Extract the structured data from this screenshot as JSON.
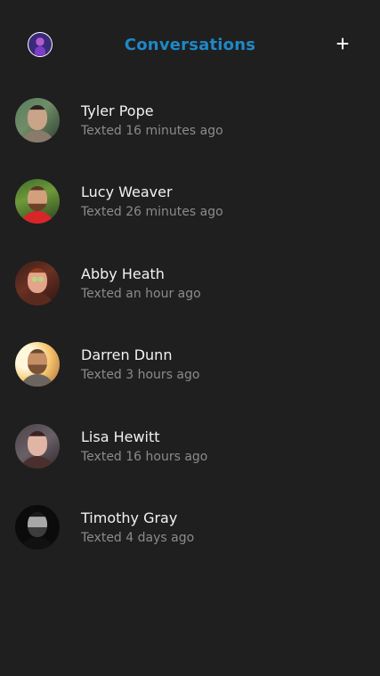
{
  "header": {
    "title": "Conversations",
    "profile_icon": "profile-avatar",
    "add_icon": "plus-icon",
    "accent_color": "#1e88c8"
  },
  "conversations": [
    {
      "name": "Tyler Pope",
      "status": "Texted 16 minutes ago"
    },
    {
      "name": "Lucy Weaver",
      "status": "Texted 26 minutes ago"
    },
    {
      "name": "Abby Heath",
      "status": "Texted an hour ago"
    },
    {
      "name": "Darren Dunn",
      "status": "Texted 3 hours ago"
    },
    {
      "name": "Lisa Hewitt",
      "status": "Texted 16 hours ago"
    },
    {
      "name": "Timothy Gray",
      "status": "Texted 4 days ago"
    }
  ]
}
